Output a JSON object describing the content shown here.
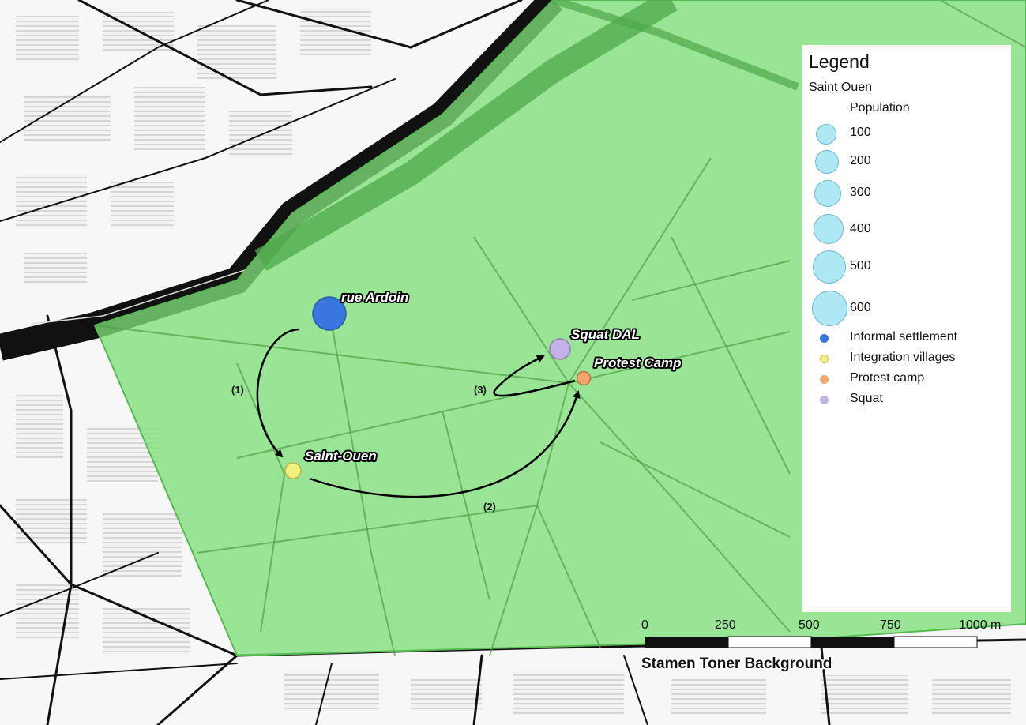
{
  "map": {
    "attribution": "Stamen Toner Background",
    "places": [
      {
        "name": "rue Ardoin",
        "category": "Informal settlement",
        "population": 600
      },
      {
        "name": "Saint-Ouen",
        "category": "Integration villages",
        "population": 100
      },
      {
        "name": "Squat DAL",
        "category": "Squat",
        "population": 200
      },
      {
        "name": "Protest Camp",
        "category": "Protest camp",
        "population": 100
      }
    ],
    "routes": [
      {
        "step": "(1)",
        "from": "rue Ardoin",
        "to": "Saint-Ouen"
      },
      {
        "step": "(2)",
        "from": "Saint-Ouen",
        "to": "Protest Camp"
      },
      {
        "step": "(3)",
        "from": "Protest Camp",
        "to": "Squat DAL"
      }
    ],
    "scale_bar": {
      "labels": [
        "0",
        "250",
        "500",
        "750",
        "1000 m"
      ]
    },
    "colors": {
      "area_fill": "#7fe07a",
      "informal_settlement": "#3a76e0",
      "integration_villages": "#f2f07e",
      "protest_camp": "#f3a56b",
      "squat": "#c4b1e6",
      "population_symbol": "#aee8f5"
    }
  },
  "legend": {
    "title": "Legend",
    "layer": "Saint Ouen",
    "population_title": "Population",
    "population_classes": [
      "100",
      "200",
      "300",
      "400",
      "500",
      "600"
    ],
    "categories": [
      {
        "label": "Informal settlement",
        "color": "#3a76e0"
      },
      {
        "label": "Integration villages",
        "color": "#f2f07e"
      },
      {
        "label": "Protest camp",
        "color": "#f3a56b"
      },
      {
        "label": "Squat",
        "color": "#c4b1e6"
      }
    ]
  }
}
